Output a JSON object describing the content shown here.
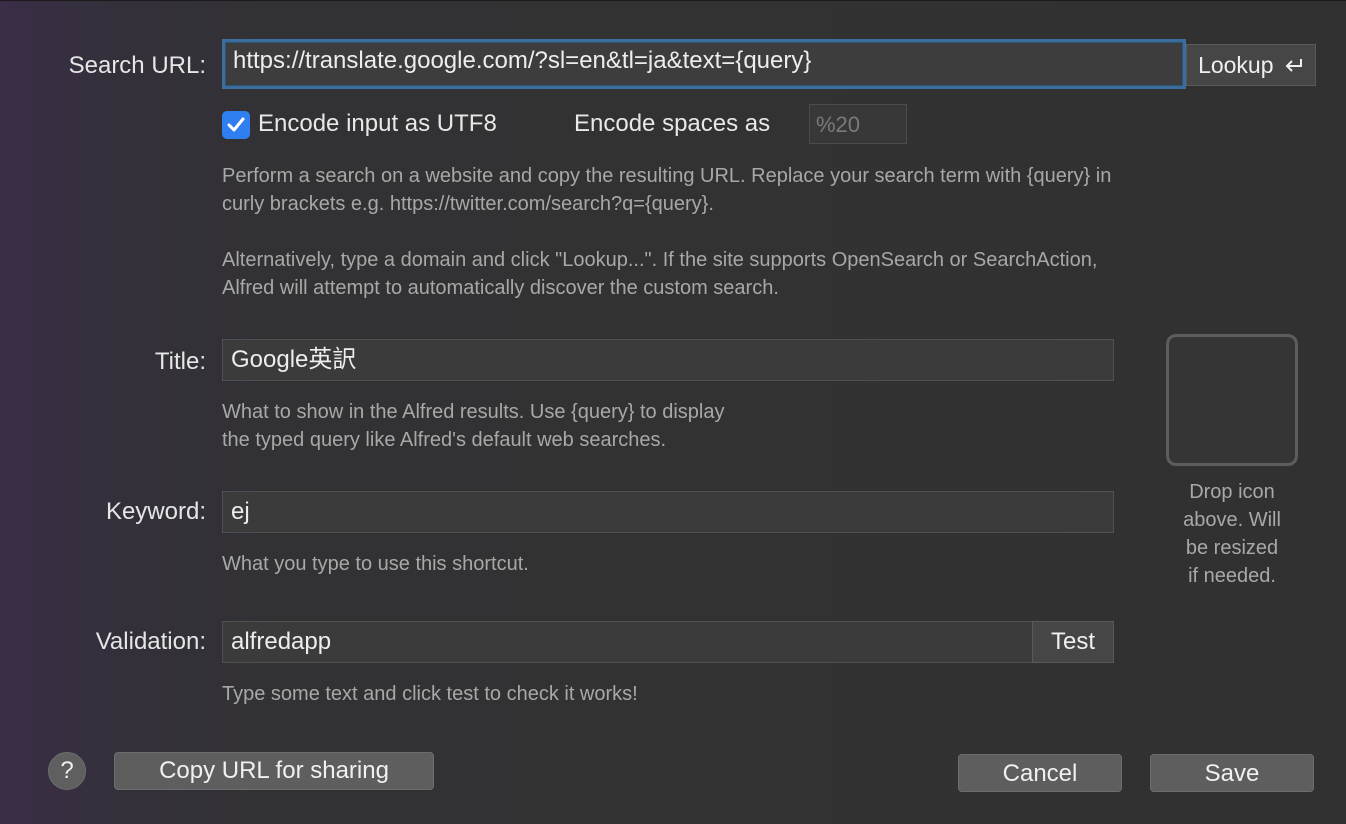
{
  "search_url": {
    "label": "Search URL:",
    "value": "https://translate.google.com/?sl=en&tl=ja&text={query}",
    "lookup_label": "Lookup",
    "lookup_icon": "return-arrow-icon"
  },
  "encoding": {
    "utf8_label": "Encode input as UTF8",
    "utf8_checked": true,
    "spaces_label": "Encode spaces as",
    "spaces_placeholder": "%20"
  },
  "search_help": {
    "line1": "Perform a search on a website and copy the resulting URL. Replace your search term with {query} in",
    "line2": "curly brackets e.g. https://twitter.com/search?q={query}.",
    "line3": "Alternatively, type a domain and click \"Lookup...\". If the site supports OpenSearch or SearchAction,",
    "line4": "Alfred will attempt to automatically discover the custom search."
  },
  "title": {
    "label": "Title:",
    "value": "Google英訳",
    "help1": "What to show in the Alfred results. Use {query} to display",
    "help2": "the typed query like Alfred's default web searches."
  },
  "keyword": {
    "label": "Keyword:",
    "value": "ej",
    "help": "What you type to use this shortcut."
  },
  "validation": {
    "label": "Validation:",
    "value": "alfredapp",
    "test_label": "Test",
    "help": "Type some text and click test to check it works!"
  },
  "icon_well": {
    "help1": "Drop icon",
    "help2": "above. Will",
    "help3": "be resized",
    "help4": "if needed."
  },
  "footer": {
    "help_glyph": "?",
    "copy_label": "Copy URL for sharing",
    "cancel_label": "Cancel",
    "save_label": "Save"
  },
  "colors": {
    "accent": "#2f7ff0",
    "focus_ring": "#3b6e9c"
  }
}
